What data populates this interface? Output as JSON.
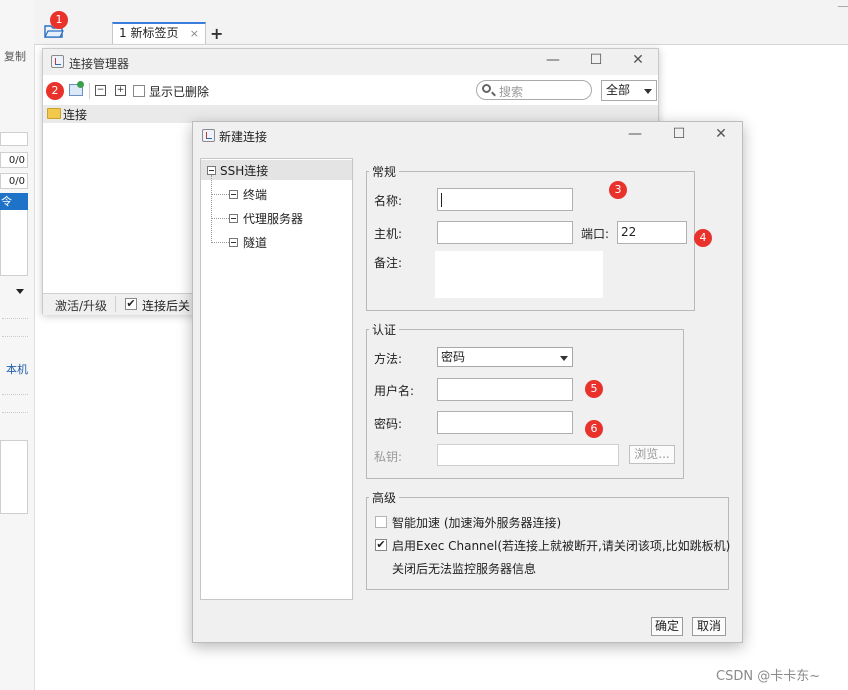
{
  "annotations": [
    "1",
    "2",
    "3",
    "4",
    "5",
    "6"
  ],
  "left_panel": {
    "copy_label": "复制",
    "counter_1": "0/0",
    "counter_2": "0/0",
    "highlight_text": "令",
    "local_label": "本机"
  },
  "tabs": {
    "items": [
      {
        "label": "1 新标签页",
        "close": "×"
      }
    ],
    "add": "+"
  },
  "conn_manager": {
    "title": "连接管理器",
    "show_deleted": "显示已删除",
    "search_placeholder": "搜索",
    "filter_value": "全部",
    "folder_label": "连接",
    "footer_activate": "激活/升级",
    "footer_connect_after": "连接后关",
    "controls": {
      "minimize": "—",
      "maximize": "☐",
      "close": "✕"
    }
  },
  "dialog": {
    "title": "新建连接",
    "controls": {
      "minimize": "—",
      "maximize": "☐",
      "close": "✕"
    },
    "tree": {
      "root": "SSH连接",
      "children": [
        "终端",
        "代理服务器",
        "隧道"
      ]
    },
    "general": {
      "legend": "常规",
      "name_label": "名称:",
      "name_value": "",
      "host_label": "主机:",
      "host_value": "",
      "port_label": "端口:",
      "port_value": "22",
      "note_label": "备注:"
    },
    "auth": {
      "legend": "认证",
      "method_label": "方法:",
      "method_value": "密码",
      "user_label": "用户名:",
      "password_label": "密码:",
      "key_label": "私钥:",
      "browse_label": "浏览..."
    },
    "advanced": {
      "legend": "高级",
      "smart_accel": "智能加速 (加速海外服务器连接)",
      "exec_channel": "启用Exec Channel(若连接上就被断开,请关闭该项,比如跳板机)",
      "exec_note": "关闭后无法监控服务器信息",
      "smart_accel_checked": false,
      "exec_channel_checked": true
    },
    "ok_label": "确定",
    "cancel_label": "取消"
  },
  "watermark": "CSDN @卡卡东~"
}
